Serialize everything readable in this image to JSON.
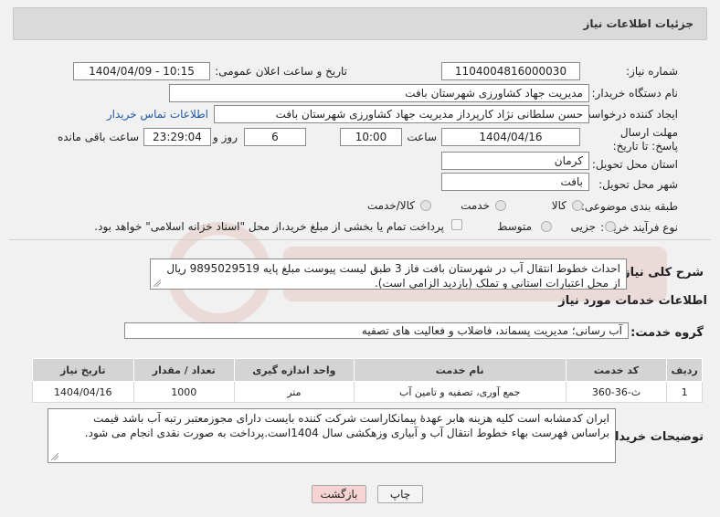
{
  "header": {
    "title": "جزئیات اطلاعات نیاز"
  },
  "form": {
    "need_number_label": "شماره نیاز:",
    "need_number": "1104004816000030",
    "announce_label": "تاریخ و ساعت اعلان عمومی:",
    "announce_value": "1404/04/09 - 10:15",
    "buyer_org_label": "نام دستگاه خریدار:",
    "buyer_org": "مدیریت جهاد کشاورزی شهرستان بافت",
    "creator_label": "ایجاد کننده درخواست:",
    "creator": "حسن سلطانی نژاد کارپرداز مدیریت جهاد کشاورزی شهرستان بافت",
    "contact_link": "اطلاعات تماس خریدار",
    "deadline_label": "مهلت ارسال پاسخ: تا تاریخ:",
    "deadline_date": "1404/04/16",
    "time_label": "ساعت",
    "deadline_time": "10:00",
    "days_value": "6",
    "days_label": "روز و",
    "remaining_time": "23:29:04",
    "remaining_label": "ساعت باقی مانده",
    "province_label": "استان محل تحویل:",
    "province": "کرمان",
    "city_label": "شهر محل تحویل:",
    "city": "بافت",
    "category_label": "طبقه بندی موضوعی:",
    "category_options": [
      "کالا",
      "خدمت",
      "کالا/خدمت"
    ],
    "category_selected": "خدمت",
    "process_label": "نوع فرآیند خرید :",
    "process_options": [
      "جزیی",
      "متوسط"
    ],
    "payment_note": "پرداخت تمام یا بخشی از مبلغ خرید،از محل \"اسناد خزانه اسلامی\" خواهد بود."
  },
  "description": {
    "label": "شرح کلی نیاز:",
    "text": "احداث خطوط انتقال آب در شهرستان بافت فاز 3 طبق لیست پیوست  مبلغ پایه 9895029519 ریال از محل اعتبارات استانی و تملک (بازدید الزامی است)."
  },
  "services": {
    "section_title": "اطلاعات خدمات مورد نیاز",
    "group_label": "گروه خدمت:",
    "group_value": "آب رسانی؛ مدیریت پسماند، فاضلاب و فعالیت های تصفیه",
    "table": {
      "headers": [
        "ردیف",
        "کد خدمت",
        "نام خدمت",
        "واحد اندازه گیری",
        "تعداد / مقدار",
        "تاریخ نیاز"
      ],
      "rows": [
        [
          "1",
          "ث-36-360",
          "جمع آوری، تصفیه و تامین آب",
          "متر",
          "1000",
          "1404/04/16"
        ]
      ]
    }
  },
  "buyer_notes": {
    "label": "توضیحات خریدار:",
    "text": "ایران کدمشابه است کلیه هزینه هابر عهدهٔ پیمانکاراست شرکت کننده بایست دارای مجوزمعتبر رتبه آب باشد قیمت براساس فهرست بهاء خطوط انتقال آب و آبیاری وزهکشی سال 1404است.پرداخت به صورت نقدی  انجام می شود."
  },
  "buttons": {
    "print": "چاپ",
    "back": "بازگشت"
  },
  "colors": {
    "back_button_bg": "#f6d4d4",
    "link": "#1f5aa6",
    "header_bg": "#dadada"
  }
}
